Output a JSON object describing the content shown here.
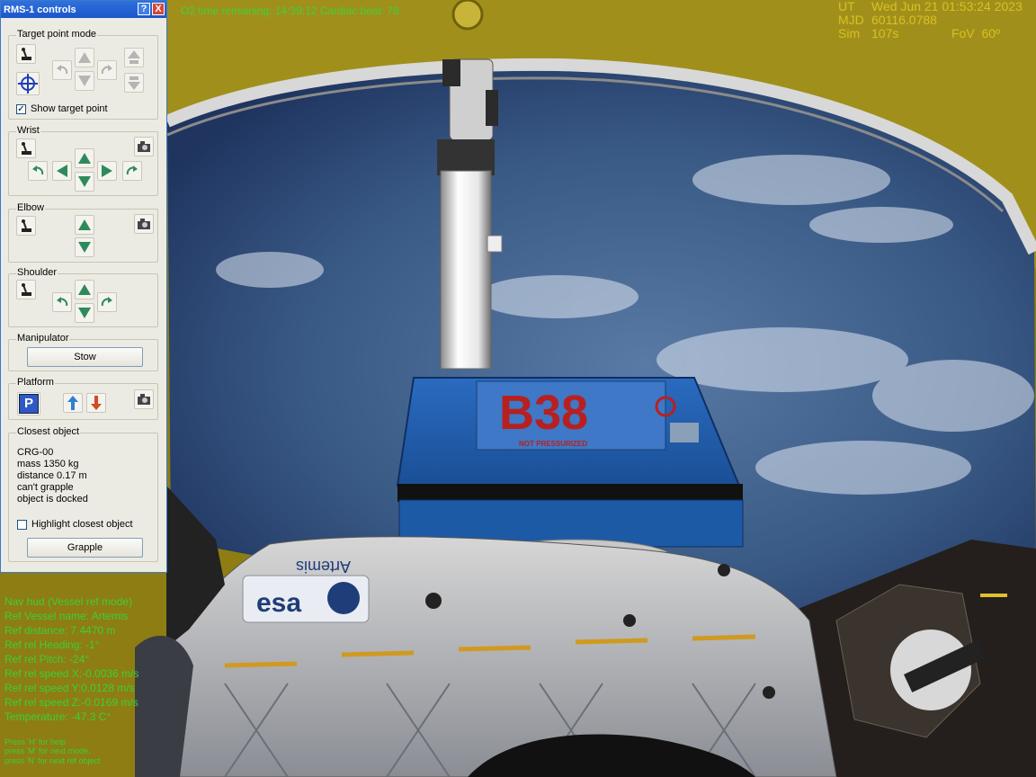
{
  "hud": {
    "top_status": "O2 time remaining: 14:39:12  Cardiac beat: 78",
    "ut_label": "UT",
    "ut_value": "Wed Jun 21 01:53:24 2023",
    "mjd_label": "MJD",
    "mjd_value": "60116.0788",
    "sim_label": "Sim",
    "sim_value": "107s",
    "fov_label": "FoV",
    "fov_value": "60º"
  },
  "nav_hud": {
    "lines": [
      "Nav hud (Vessel ref mode)",
      "Ref Vessel name: Artemis",
      "Ref distance: 7.4470 m",
      "Ref rel Heading: -1°",
      "Ref rel Pitch: -24°",
      "Ref rel speed X:-0.0036 m/s",
      "Ref rel speed Y:0.0128 m/s",
      "Ref rel speed Z:-0.0169 m/s",
      "Temperature: -47.3 C°"
    ],
    "help": [
      "Press 'H' for help",
      "press 'M' for next mode.",
      "press 'N' for next ref object"
    ]
  },
  "dialog": {
    "title": "RMS-1 controls",
    "help_btn": "?",
    "close_btn": "X",
    "target_point_mode": "Target point mode",
    "show_target_point": "Show target point",
    "show_target_checked": "✓",
    "wrist": "Wrist",
    "elbow": "Elbow",
    "shoulder": "Shoulder",
    "manipulator": "Manipulator",
    "stow": "Stow",
    "platform": "Platform",
    "platform_p": "P",
    "closest_object": "Closest object",
    "closest_info": [
      "CRG-00",
      "mass  1350 kg",
      "distance 0.17 m",
      "can't grapple",
      "object is docked"
    ],
    "highlight_closest": "Highlight closest object",
    "grapple": "Grapple"
  },
  "scene_labels": {
    "cargo_code": "B38",
    "cargo_sub": "NOT PRESSURIZED",
    "module_name": "Artemis",
    "agency_logo": "esa"
  },
  "colors": {
    "hud_yellow": "#d6c21e",
    "hud_green": "#3ad03a",
    "titlebar": "#2f71dd",
    "dialog_bg": "#ecebe3",
    "cargo_blue": "#1f5ea8",
    "cargo_red": "#b82020",
    "sky": "#3f5f8c",
    "fairing_yellow": "#9b8a17"
  }
}
